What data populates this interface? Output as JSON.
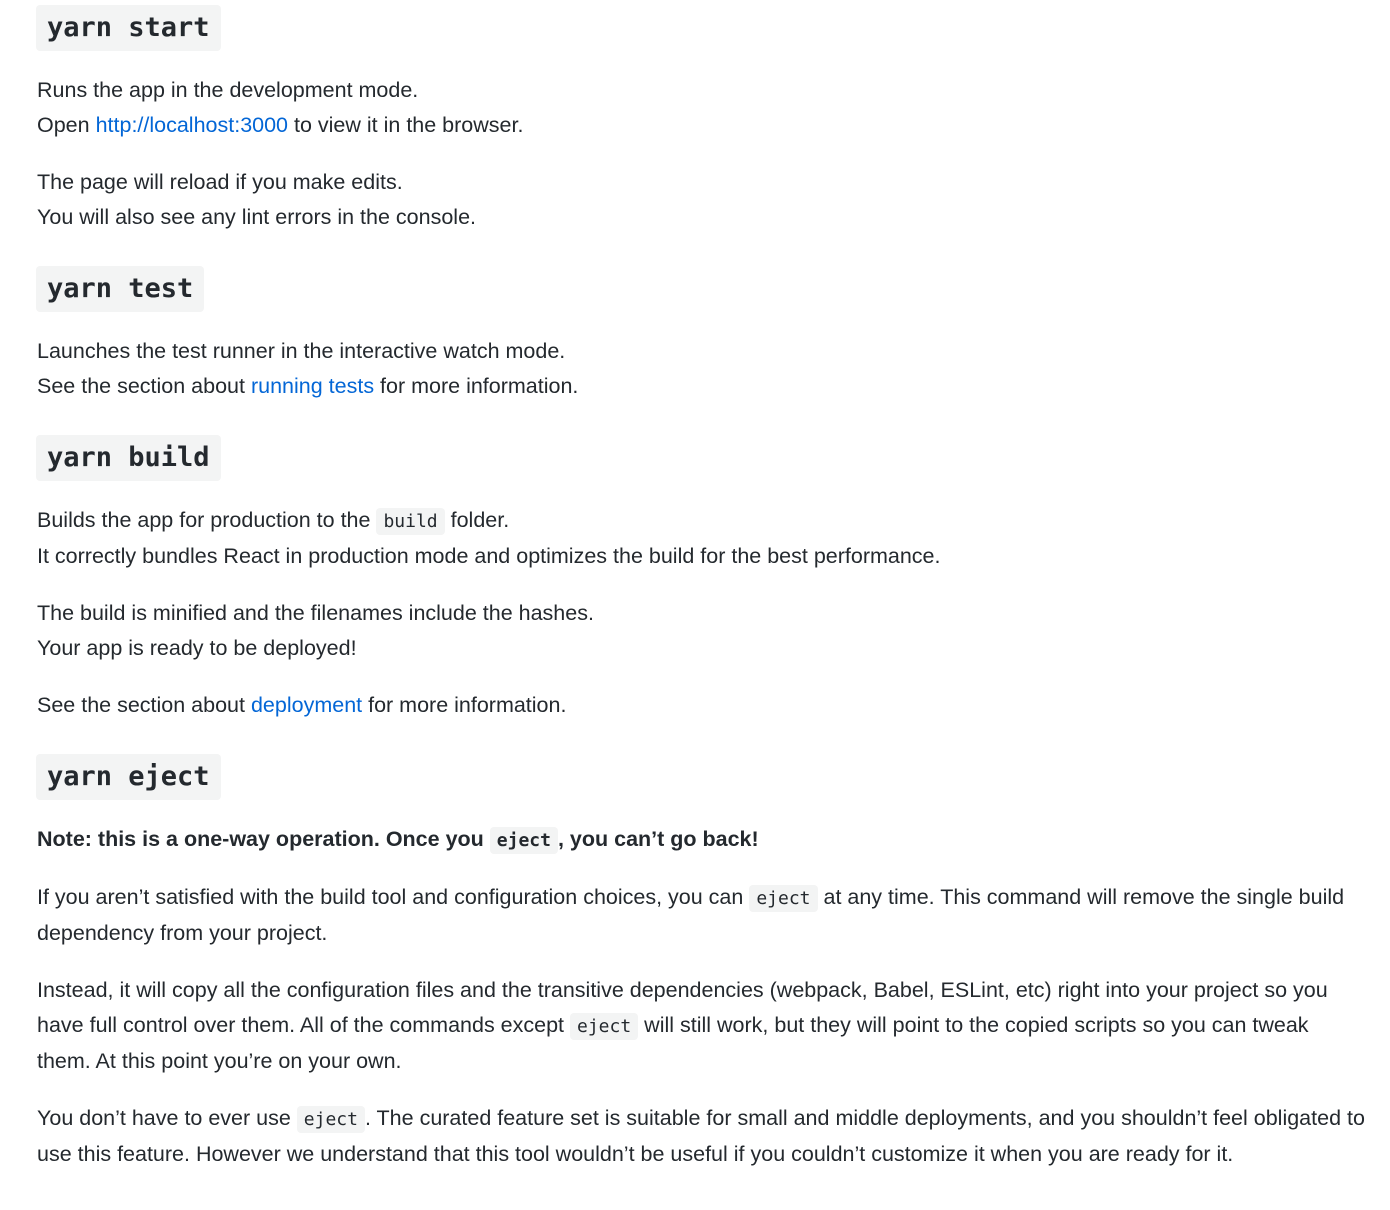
{
  "sections": [
    {
      "heading": "yarn start",
      "p1": {
        "l1": "Runs the app in the development mode.",
        "l2a": "Open ",
        "link": "http://localhost:3000",
        "l2b": " to view it in the browser."
      },
      "p2": {
        "l1": "The page will reload if you make edits.",
        "l2": "You will also see any lint errors in the console."
      }
    },
    {
      "heading": "yarn test",
      "p1": {
        "l1": "Launches the test runner in the interactive watch mode.",
        "l2a": "See the section about ",
        "link": "running tests",
        "l2b": " for more information."
      }
    },
    {
      "heading": "yarn build",
      "p1": {
        "l1a": "Builds the app for production to the ",
        "code": "build",
        "l1b": " folder.",
        "l2": "It correctly bundles React in production mode and optimizes the build for the best performance."
      },
      "p2": {
        "l1": "The build is minified and the filenames include the hashes.",
        "l2": "Your app is ready to be deployed!"
      },
      "p3": {
        "a": "See the section about ",
        "link": "deployment",
        "b": " for more information."
      }
    },
    {
      "heading": "yarn eject",
      "note": {
        "a": "Note: this is a one-way operation. Once you ",
        "code": "eject",
        "b": ", you can’t go back!"
      },
      "p1": {
        "a": "If you aren’t satisfied with the build tool and configuration choices, you can ",
        "code": "eject",
        "b": " at any time. This command will remove the single build dependency from your project."
      },
      "p2": {
        "a": "Instead, it will copy all the configuration files and the transitive dependencies (webpack, Babel, ESLint, etc) right into your project so you have full control over them. All of the commands except ",
        "code": "eject",
        "b": " will still work, but they will point to the copied scripts so you can tweak them. At this point you’re on your own."
      },
      "p3": {
        "a": "You don’t have to ever use ",
        "code": "eject",
        "b": ". The curated feature set is suitable for small and middle deployments, and you shouldn’t feel obligated to use this feature. However we understand that this tool wouldn’t be useful if you couldn’t customize it when you are ready for it."
      }
    }
  ]
}
